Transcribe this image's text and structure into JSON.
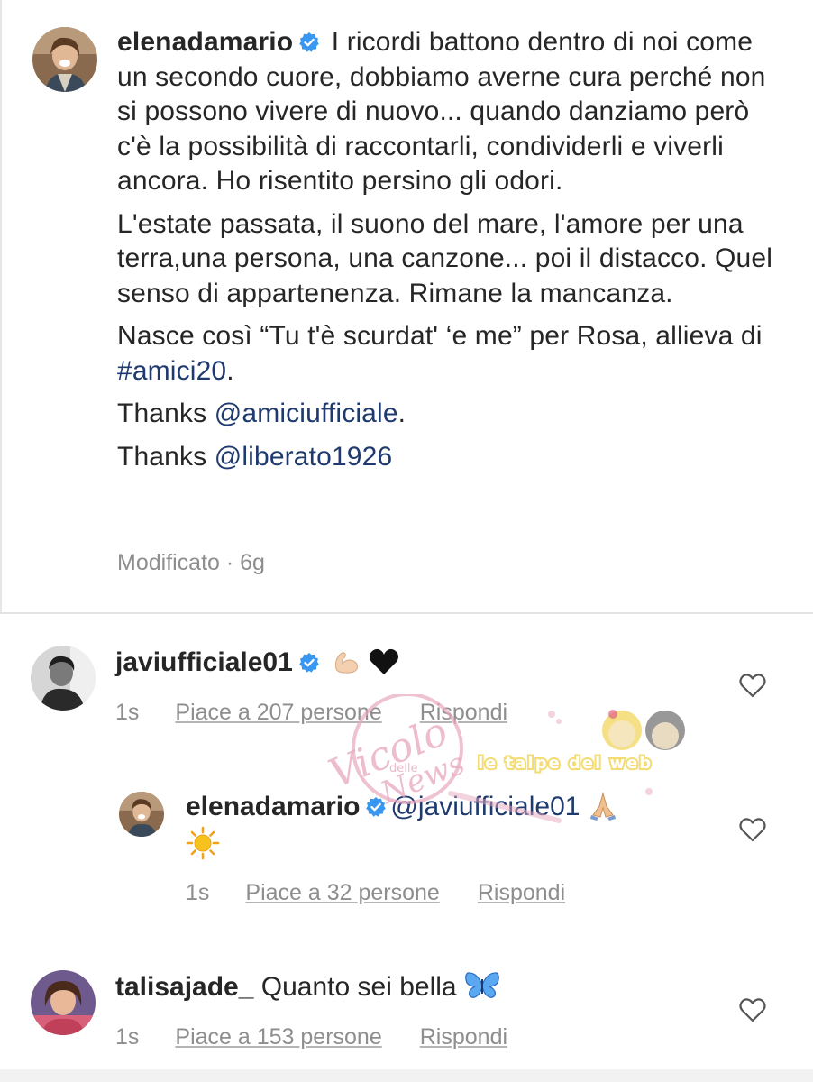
{
  "caption": {
    "username": "elenadamario",
    "paragraphs": {
      "p1": "I ricordi battono dentro di noi come un secondo cuore, dobbiamo averne cura perché non si possono vivere di nuovo... quando danziamo però c'è la possibilità di raccontarli, condividerli e viverli ancora. Ho risentito persino gli odori.",
      "p2": "L'estate passata, il suono del mare, l'amore per una terra,una persona, una canzone... poi il distacco. Quel senso di appartenenza. Rimane la mancanza.",
      "p3_before": "Nasce così “Tu t'è scurdat' ‘e me” per Rosa, allieva di ",
      "p3_hashtag": "#amici20",
      "p3_after": ".",
      "p4_before": "Thanks ",
      "p4_mention": "@amiciufficiale",
      "p4_after": ".",
      "p5_before": "Thanks ",
      "p5_mention": "@liberato1926"
    },
    "meta": "Modificato · 6g"
  },
  "comments": [
    {
      "username": "javiufficiale01",
      "time": "1s",
      "likes": "Piace a 207 persone",
      "reply": "Rispondi"
    },
    {
      "username": "elenadamario",
      "mention": "@javiufficiale01",
      "time": "1s",
      "likes": "Piace a 32 persone",
      "reply": "Rispondi"
    },
    {
      "username": "talisajade_",
      "text": "Quanto sei bella",
      "time": "1s",
      "likes": "Piace a 153 persone",
      "reply": "Rispondi"
    }
  ],
  "watermarks": {
    "vicolo": "Vicolo",
    "delle": "delle",
    "news": "News",
    "talpe": "le talpe del web"
  },
  "colors": {
    "link": "#1e3a6e",
    "verified": "#3897f0",
    "meta": "#8e8e8e",
    "watermark_pink": "#e8a8bf",
    "watermark_yellow": "#f2d65c"
  },
  "icons": {
    "verified": "verified-badge-icon",
    "heart": "heart-outline-icon",
    "muscle": "flexed-biceps-emoji",
    "black_heart": "black-heart-emoji",
    "pray": "folded-hands-emoji",
    "sun": "sun-emoji",
    "butterfly": "butterfly-emoji"
  }
}
